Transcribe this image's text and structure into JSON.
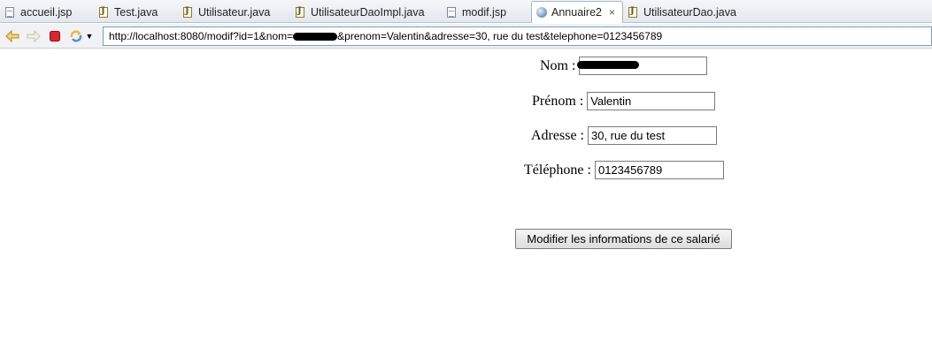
{
  "tabs": [
    {
      "label": "accueil.jsp",
      "icon": "jsp-file-icon"
    },
    {
      "label": "Test.java",
      "icon": "java-file-icon"
    },
    {
      "label": "Utilisateur.java",
      "icon": "java-file-icon"
    },
    {
      "label": "UtilisateurDaoImpl.java",
      "icon": "java-file-icon"
    },
    {
      "label": "modif.jsp",
      "icon": "jsp-file-icon"
    },
    {
      "label": "Annuaire2",
      "icon": "globe-icon",
      "active": true,
      "close": "×"
    },
    {
      "label": "UtilisateurDao.java",
      "icon": "java-file-icon"
    }
  ],
  "nav": {
    "url": "http://localhost:8080/modif?id=1&nom=",
    "url_rest": "&prenom=Valentin&adresse=30, rue du test&telephone=0123456789",
    "icons": [
      "back-arrow-icon",
      "forward-arrow-icon",
      "stop-icon",
      "refresh-icon",
      "dropdown-icon"
    ]
  },
  "form": {
    "nom": {
      "label": "Nom :",
      "value": ""
    },
    "prenom": {
      "label": "Prénom :",
      "value": "Valentin"
    },
    "adresse": {
      "label": "Adresse :",
      "value": "30, rue du test"
    },
    "telephone": {
      "label": "Téléphone :",
      "value": "0123456789"
    },
    "submit_label": "Modifier les informations de ce salarié"
  },
  "colors": {
    "tab_bar": "#e3e8ee",
    "nav_bar": "#f0f2f5",
    "url_border": "#7f9db9",
    "stop_red": "#d9262b",
    "arrow_yellow": "#e8b83a"
  }
}
